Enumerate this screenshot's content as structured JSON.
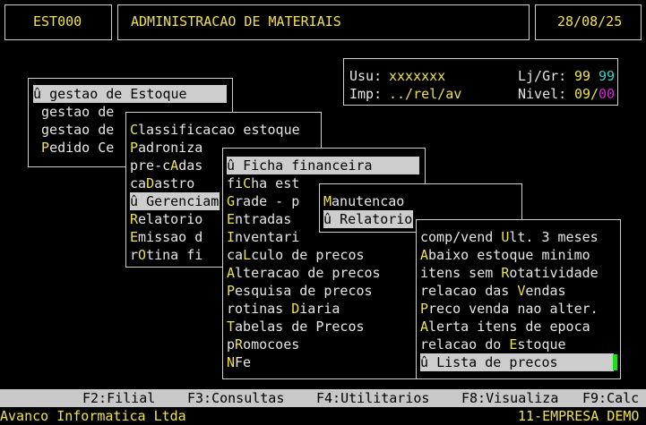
{
  "header": {
    "code": "EST000",
    "title": "ADMINISTRACAO DE MATERIAIS",
    "date": "28/08/25"
  },
  "info": {
    "usu_label": "Usu:",
    "usu_value": "xxxxxxx",
    "imp_label": "Imp:",
    "imp_value": "../rel/av",
    "ljgr_label": "Lj/Gr:",
    "lj_value": "99",
    "gr_value": "99",
    "nivel_label": "Nivel:",
    "nivel_value": "09",
    "nivel_sep": "/",
    "nivel_value2": "00"
  },
  "menu1": {
    "items": [
      {
        "pre": "û ",
        "hot": "",
        "rest": "gestao de Estoque"
      },
      {
        "pre": " ",
        "hot": "",
        "rest": "gestao de"
      },
      {
        "pre": " ",
        "hot": "",
        "rest": "gestao de"
      },
      {
        "pre": " ",
        "hot": "P",
        "rest": "edido Ce"
      }
    ]
  },
  "menu2": {
    "items": [
      {
        "pre": "",
        "hot": "C",
        "rest": "lassificacao estoque"
      },
      {
        "pre": "",
        "hot": "P",
        "rest": "adroniza"
      },
      {
        "pre": "",
        "hot": "",
        "rest": "pre-c",
        "hot2": "A",
        "rest2": "das"
      },
      {
        "pre": "",
        "hot": "",
        "rest": "ca",
        "hot2": "D",
        "rest2": "astro"
      },
      {
        "pre": "û ",
        "hot": "",
        "rest": "Gerenciam"
      },
      {
        "pre": "",
        "hot": "R",
        "rest": "elatorio"
      },
      {
        "pre": "",
        "hot": "E",
        "rest": "missao d"
      },
      {
        "pre": "",
        "hot": "",
        "rest": "r",
        "hot2": "O",
        "rest2": "tina fi"
      }
    ]
  },
  "menu3": {
    "items": [
      {
        "pre": "û ",
        "hot": "",
        "rest": "Ficha financeira"
      },
      {
        "pre": "",
        "hot": "",
        "rest": "fi",
        "hot2": "C",
        "rest2": "ha est"
      },
      {
        "pre": "",
        "hot": "G",
        "rest": "rade - p"
      },
      {
        "pre": "",
        "hot": "E",
        "rest": "ntradas"
      },
      {
        "pre": "",
        "hot": "I",
        "rest": "nventari"
      },
      {
        "pre": "",
        "hot": "",
        "rest": "ca",
        "hot2": "L",
        "rest2": "culo de precos"
      },
      {
        "pre": "",
        "hot": "A",
        "rest": "lteracao de precos"
      },
      {
        "pre": "",
        "hot": "P",
        "rest": "esquisa de precos"
      },
      {
        "pre": "",
        "hot": "",
        "rest": "rotinas ",
        "hot2": "D",
        "rest2": "iaria"
      },
      {
        "pre": "",
        "hot": "T",
        "rest": "abelas de Precos"
      },
      {
        "pre": "",
        "hot": "",
        "rest": "p",
        "hot2": "R",
        "rest2": "omocoes"
      },
      {
        "pre": "",
        "hot": "N",
        "rest": "Fe"
      }
    ]
  },
  "menu4": {
    "items": [
      {
        "pre": "",
        "hot": "M",
        "rest": "anutencao"
      },
      {
        "pre": "û ",
        "hot": "",
        "rest": "Relatorio"
      }
    ]
  },
  "menu5": {
    "items": [
      {
        "pre": "",
        "hot": "",
        "rest": "comp/vend ",
        "hot2": "U",
        "rest2": "lt. 3 meses"
      },
      {
        "pre": "",
        "hot": "A",
        "rest": "baixo estoque minimo"
      },
      {
        "pre": "",
        "hot": "",
        "rest": "itens sem ",
        "hot2": "R",
        "rest2": "otatividade"
      },
      {
        "pre": "",
        "hot": "",
        "rest": "relacao das ",
        "hot2": "V",
        "rest2": "endas"
      },
      {
        "pre": "",
        "hot": "P",
        "rest": "reco venda nao alter."
      },
      {
        "pre": "",
        "hot": "A",
        "rest": "lerta itens de epoca"
      },
      {
        "pre": "",
        "hot": "",
        "rest": "relacao do ",
        "hot2": "E",
        "rest2": "stoque"
      },
      {
        "pre": "û ",
        "hot": "",
        "rest": "Lista de precos"
      }
    ]
  },
  "fkeys": [
    "F2:Filial",
    "F3:Consultas",
    "F4:Utilitarios",
    "F8:Visualiza",
    "F9:Calc"
  ],
  "footer": {
    "company": "Avanco Informatica Ltda",
    "empresa": "11-EMPRESA DEMO"
  },
  "colors": {
    "yellow": "#f2e24a",
    "cyan": "#35d0d0",
    "magenta": "#e020e0",
    "highlight": "#cdcdcd",
    "cursor": "#19e019"
  }
}
